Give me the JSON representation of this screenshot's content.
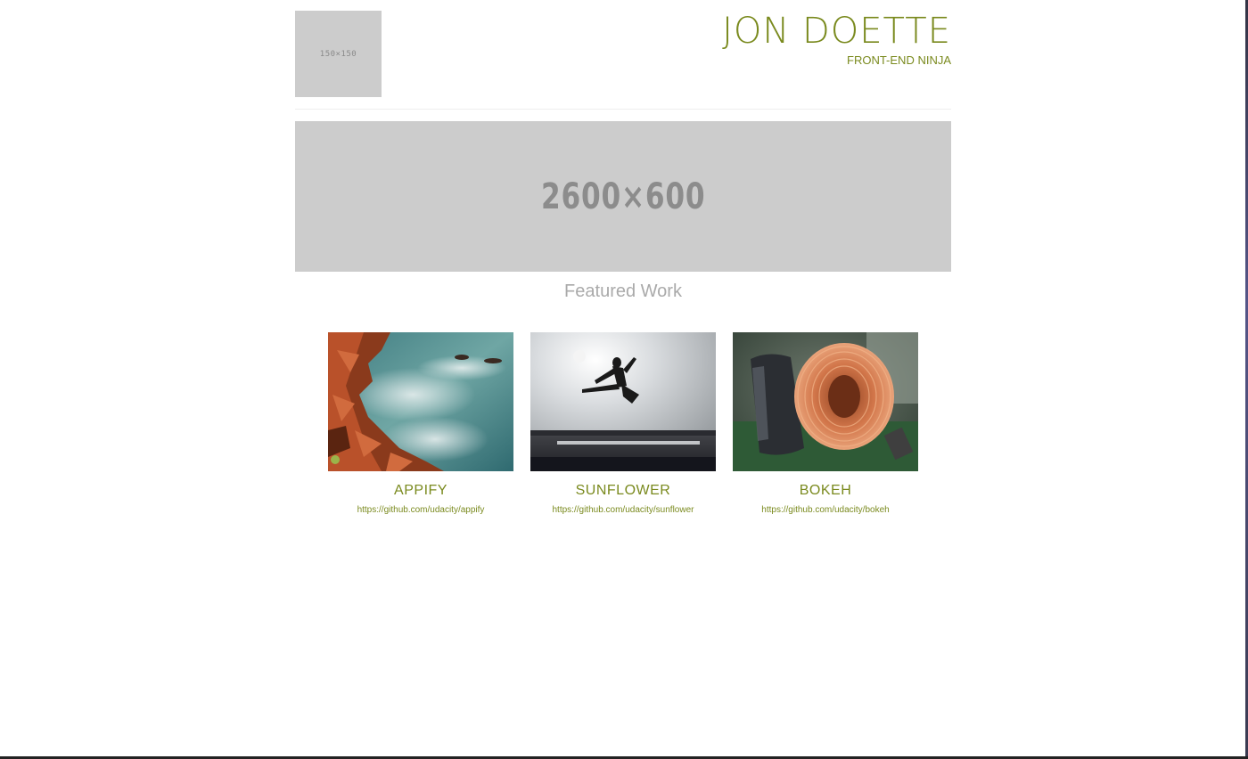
{
  "header": {
    "logo_placeholder": "150×150",
    "name": "JON DOETTE",
    "subtitle": "FRONT-END NINJA"
  },
  "hero": {
    "placeholder": "2600×600"
  },
  "featured": {
    "heading": "Featured Work",
    "projects": [
      {
        "title": "APPIFY",
        "url": "https://github.com/udacity/appify",
        "image": "rocky-coast-photo"
      },
      {
        "title": "SUNFLOWER",
        "url": "https://github.com/udacity/sunflower",
        "image": "jumping-kick-silhouette-photo"
      },
      {
        "title": "BOKEH",
        "url": "https://github.com/udacity/bokeh",
        "image": "copper-coil-inductor-photo"
      }
    ]
  },
  "colors": {
    "accent": "#7a8a1e",
    "placeholder_bg": "#cccccc",
    "heading_gray": "#aaaaaa"
  }
}
